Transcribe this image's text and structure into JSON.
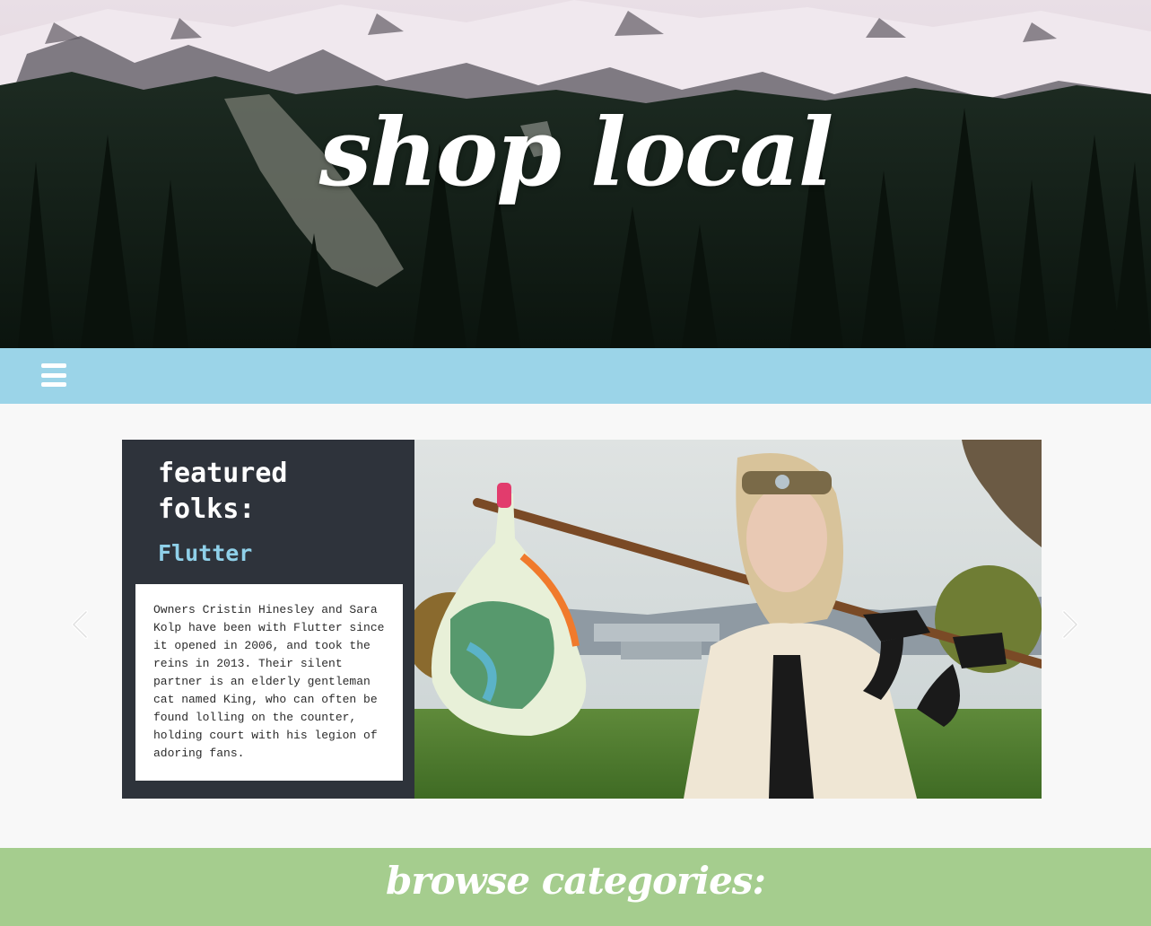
{
  "hero": {
    "title": "shop local",
    "background_image": "snowy-mountains-forest"
  },
  "nav": {
    "menu_icon": "hamburger-icon",
    "background_color": "#9bd4e8"
  },
  "featured": {
    "heading": "featured folks:",
    "name": "Flutter",
    "description": "Owners Cristin Hinesley and Sara Kolp have been with Flutter since it opened in 2006, and took the reins in 2013. Their silent partner is an elderly gentleman cat named King, who can often be found lolling on the counter, holding court with his legion of adoring fans.",
    "photo": "woman-with-bindle-photo",
    "panel_color": "#2e333b",
    "name_color": "#8fd0e9"
  },
  "carousel": {
    "prev_icon": "chevron-left-icon",
    "next_icon": "chevron-right-icon"
  },
  "browse": {
    "title": "browse categories:",
    "background_color": "#a5cd8e"
  }
}
